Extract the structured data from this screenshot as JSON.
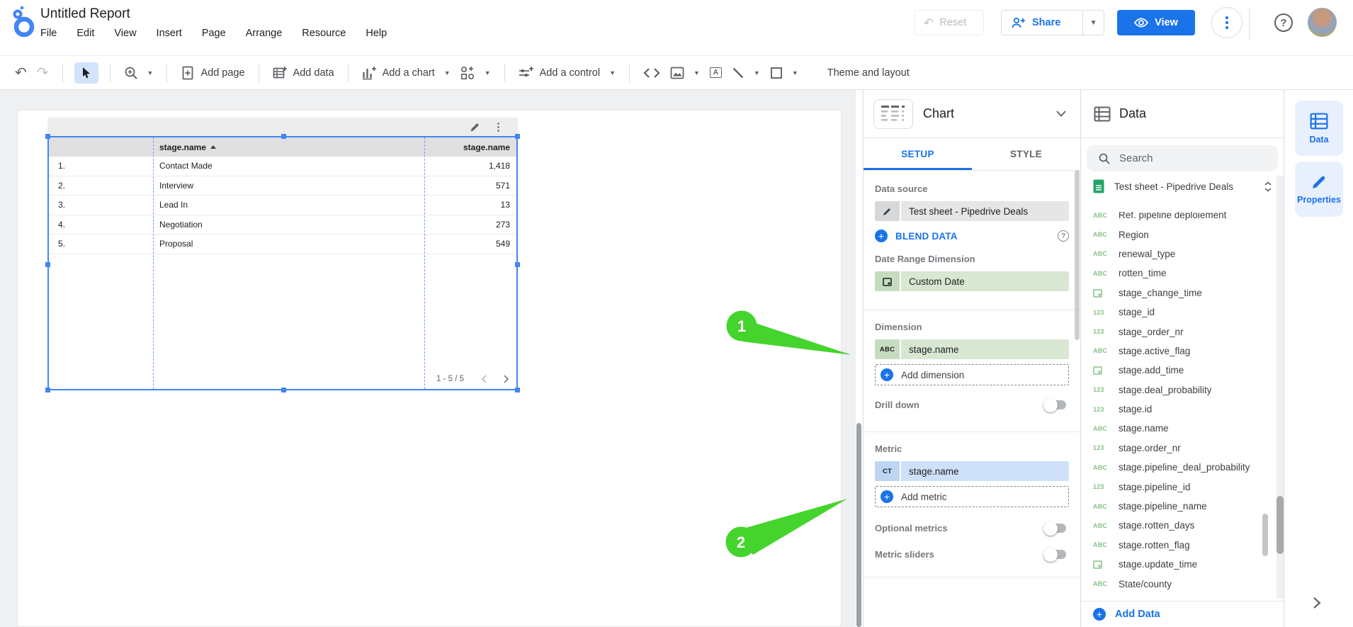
{
  "app": {
    "title": "Untitled Report"
  },
  "menubar": {
    "items": [
      "File",
      "Edit",
      "View",
      "Insert",
      "Page",
      "Arrange",
      "Resource",
      "Help"
    ]
  },
  "header_actions": {
    "reset_label": "Reset",
    "share_label": "Share",
    "view_label": "View"
  },
  "toolbar": {
    "add_page_label": "Add page",
    "add_data_label": "Add data",
    "add_chart_label": "Add a chart",
    "add_control_label": "Add a control",
    "theme_label": "Theme and layout"
  },
  "canvas": {
    "chart_table": {
      "dimension_header": "stage.name",
      "metric_header": "stage.name",
      "sort": "ascending",
      "rows": [
        [
          "1.",
          "Contact Made",
          "1,418"
        ],
        [
          "2.",
          "Interview",
          "571"
        ],
        [
          "3.",
          "Lead In",
          "13"
        ],
        [
          "4.",
          "Negotiation",
          "273"
        ],
        [
          "5.",
          "Proposal",
          "549"
        ]
      ],
      "pagination": "1 - 5 / 5"
    }
  },
  "setup_panel": {
    "panel_title": "Chart",
    "tabs": {
      "setup": "SETUP",
      "style": "STYLE"
    },
    "data_source_label": "Data source",
    "data_source_value": "Test sheet - Pipedrive Deals",
    "blend_label": "BLEND DATA",
    "date_range_label": "Date Range Dimension",
    "date_range_value": "Custom Date",
    "dimension_label": "Dimension",
    "dimension_chip": {
      "type_label": "ABC",
      "value": "stage.name"
    },
    "add_dimension_label": "Add dimension",
    "drill_down_label": "Drill down",
    "drill_down_enabled": false,
    "metric_label": "Metric",
    "metric_chip": {
      "type_label": "CT",
      "value": "stage.name"
    },
    "add_metric_label": "Add metric",
    "optional_metrics_label": "Optional metrics",
    "optional_metrics_enabled": false,
    "metric_sliders_label": "Metric sliders",
    "metric_sliders_enabled": false
  },
  "data_panel": {
    "title": "Data",
    "search_placeholder": "Search",
    "source_name": "Test sheet - Pipedrive Deals",
    "field_type_labels": {
      "text": "ABC",
      "number": "123"
    },
    "fields": [
      {
        "name": "Ref. pipeline deploiement",
        "type": "text"
      },
      {
        "name": "Region",
        "type": "text"
      },
      {
        "name": "renewal_type",
        "type": "text"
      },
      {
        "name": "rotten_time",
        "type": "text"
      },
      {
        "name": "stage_change_time",
        "type": "date"
      },
      {
        "name": "stage_id",
        "type": "number"
      },
      {
        "name": "stage_order_nr",
        "type": "number"
      },
      {
        "name": "stage.active_flag",
        "type": "text"
      },
      {
        "name": "stage.add_time",
        "type": "date"
      },
      {
        "name": "stage.deal_probability",
        "type": "number"
      },
      {
        "name": "stage.id",
        "type": "number"
      },
      {
        "name": "stage.name",
        "type": "text"
      },
      {
        "name": "stage.order_nr",
        "type": "number"
      },
      {
        "name": "stage.pipeline_deal_probability",
        "type": "text"
      },
      {
        "name": "stage.pipeline_id",
        "type": "number"
      },
      {
        "name": "stage.pipeline_name",
        "type": "text"
      },
      {
        "name": "stage.rotten_days",
        "type": "text"
      },
      {
        "name": "stage.rotten_flag",
        "type": "text"
      },
      {
        "name": "stage.update_time",
        "type": "date"
      },
      {
        "name": "State/county",
        "type": "text"
      }
    ],
    "add_data_label": "Add Data"
  },
  "right_rail": {
    "data_label": "Data",
    "properties_label": "Properties"
  },
  "annotations": {
    "color": "#45d42d",
    "arrow1_label": "1",
    "arrow2_label": "2"
  },
  "colors": {
    "accent_blue": "#1a73e8",
    "selection_blue": "#4285f4",
    "dimension_chip_green": "#d7e7d1",
    "metric_chip_blue": "#cfe1f8",
    "date_range_chip_green": "#d7e7d1",
    "field_icon_green": "#85c285"
  }
}
